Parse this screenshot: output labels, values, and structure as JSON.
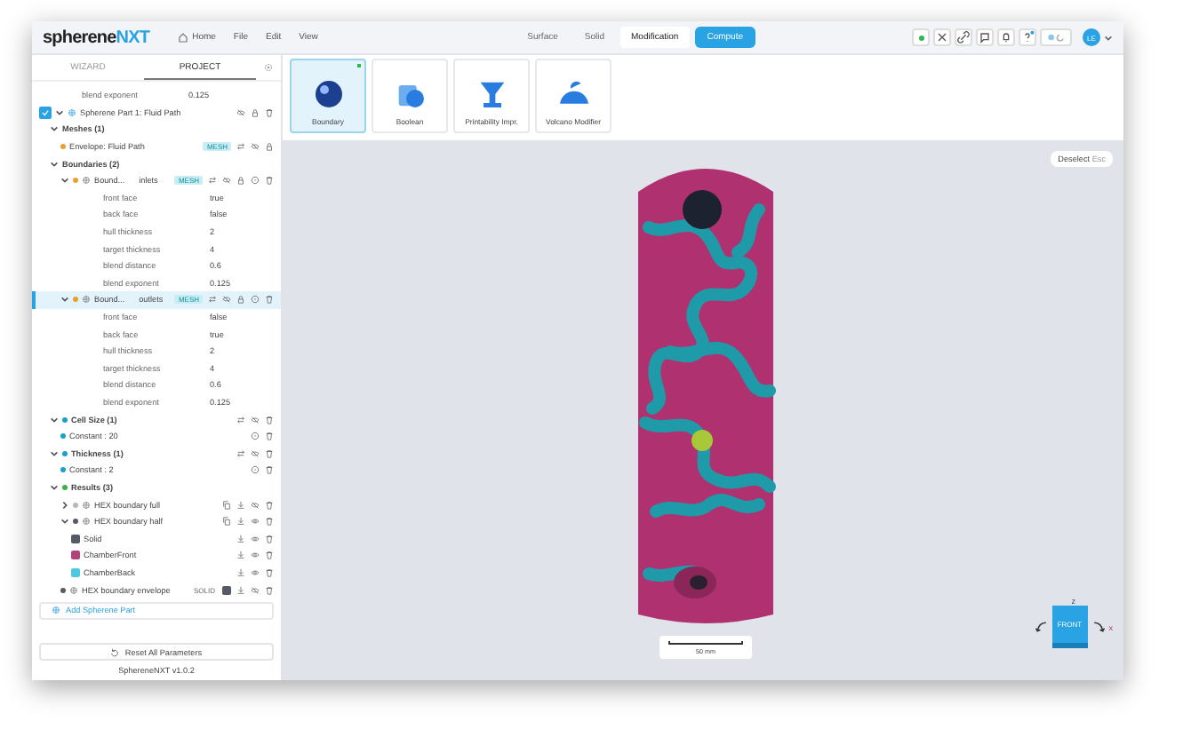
{
  "app": {
    "logo_main": "spherene",
    "logo_accent": "NXT",
    "menu": [
      {
        "label": "Home",
        "kind": "home"
      },
      {
        "label": "File",
        "kind": "plain"
      },
      {
        "label": "Edit",
        "kind": "plain"
      },
      {
        "label": "View",
        "kind": "plain"
      }
    ],
    "modes": [
      {
        "label": "Surface",
        "selected": false
      },
      {
        "label": "Solid",
        "selected": false
      },
      {
        "label": "Modification",
        "selected": true
      }
    ],
    "compute_button": "Compute",
    "user_initials": "LE"
  },
  "sidebar": {
    "tabs": [
      {
        "label": "WIZARD",
        "selected": false
      },
      {
        "label": "PROJECT",
        "selected": true
      }
    ],
    "top_props": [
      {
        "name": "blend exponent",
        "value": "0.125"
      }
    ],
    "tree": [
      {
        "label": "Spherene Part 1: Fluid Path",
        "kind": "part",
        "checked": true,
        "expanded": true,
        "selected": false,
        "actions": [
          {
            "kind": "hide"
          },
          {
            "kind": "lock"
          },
          {
            "kind": "delete"
          }
        ],
        "children": [
          {
            "label": "Meshes (1)",
            "kind": "group",
            "expanded": true,
            "selected": false,
            "children": [
              {
                "label": "Envelope: Fluid Path",
                "kind": "item",
                "color": "#e8a030",
                "tag": "MESH",
                "selected": false,
                "actions": [
                  {
                    "kind": "swap"
                  },
                  {
                    "kind": "hide"
                  },
                  {
                    "kind": "lock"
                  }
                ]
              }
            ]
          },
          {
            "label": "Boundaries (2)",
            "kind": "group",
            "expanded": true,
            "selected": false,
            "children": [
              {
                "label": "Bound...",
                "secondary": "inlets",
                "kind": "boundary",
                "color": "#e8a030",
                "tag": "MESH",
                "expanded": true,
                "selected": false,
                "actions": [
                  {
                    "kind": "swap"
                  },
                  {
                    "kind": "hide"
                  },
                  {
                    "kind": "lock"
                  },
                  {
                    "kind": "target"
                  },
                  {
                    "kind": "delete"
                  }
                ],
                "props": [
                  {
                    "name": "front face",
                    "value": "true"
                  },
                  {
                    "name": "back face",
                    "value": "false"
                  },
                  {
                    "name": "hull thickness",
                    "value": "2"
                  },
                  {
                    "name": "target thickness",
                    "value": "4"
                  },
                  {
                    "name": "blend distance",
                    "value": "0.6"
                  },
                  {
                    "name": "blend exponent",
                    "value": "0.125"
                  }
                ]
              },
              {
                "label": "Bound...",
                "secondary": "outlets",
                "kind": "boundary",
                "color": "#e8a030",
                "tag": "MESH",
                "expanded": true,
                "selected": true,
                "actions": [
                  {
                    "kind": "swap"
                  },
                  {
                    "kind": "hide"
                  },
                  {
                    "kind": "lock"
                  },
                  {
                    "kind": "target"
                  },
                  {
                    "kind": "delete"
                  }
                ],
                "props": [
                  {
                    "name": "front face",
                    "value": "false"
                  },
                  {
                    "name": "back face",
                    "value": "true"
                  },
                  {
                    "name": "hull thickness",
                    "value": "2"
                  },
                  {
                    "name": "target thickness",
                    "value": "4"
                  },
                  {
                    "name": "blend distance",
                    "value": "0.6"
                  },
                  {
                    "name": "blend exponent",
                    "value": "0.125"
                  }
                ]
              }
            ]
          },
          {
            "label": "Cell Size (1)",
            "kind": "group",
            "color": "#1ba0c8",
            "expanded": true,
            "selected": false,
            "actions": [
              {
                "kind": "swap"
              },
              {
                "kind": "hide"
              },
              {
                "kind": "delete"
              }
            ],
            "children": [
              {
                "label": "Constant : 20",
                "kind": "item",
                "color": "#1ba0c8",
                "selected": false,
                "actions": [
                  {
                    "kind": "target"
                  },
                  {
                    "kind": "delete"
                  }
                ]
              }
            ]
          },
          {
            "label": "Thickness (1)",
            "kind": "group",
            "color": "#1ba0c8",
            "expanded": true,
            "selected": false,
            "actions": [
              {
                "kind": "swap"
              },
              {
                "kind": "hide"
              },
              {
                "kind": "delete"
              }
            ],
            "children": [
              {
                "label": "Constant : 2",
                "kind": "item",
                "color": "#1ba0c8",
                "selected": false,
                "actions": [
                  {
                    "kind": "target"
                  },
                  {
                    "kind": "delete"
                  }
                ]
              }
            ]
          },
          {
            "label": "Results (3)",
            "kind": "group",
            "color": "#3cb04a",
            "expanded": true,
            "selected": false,
            "children": [
              {
                "label": "HEX boundary full",
                "kind": "result",
                "color": "#b8b8b8",
                "expanded": false,
                "selected": false,
                "actions": [
                  {
                    "kind": "copy"
                  },
                  {
                    "kind": "download"
                  },
                  {
                    "kind": "hide"
                  },
                  {
                    "kind": "delete"
                  }
                ]
              },
              {
                "label": "HEX boundary half",
                "kind": "result",
                "color": "#555a66",
                "expanded": true,
                "selected": false,
                "actions": [
                  {
                    "kind": "copy"
                  },
                  {
                    "kind": "download"
                  },
                  {
                    "kind": "eye"
                  },
                  {
                    "kind": "delete"
                  }
                ],
                "children": [
                  {
                    "label": "Solid",
                    "kind": "swatch",
                    "color": "#555a66",
                    "selected": false,
                    "actions": [
                      {
                        "kind": "download"
                      },
                      {
                        "kind": "eye"
                      },
                      {
                        "kind": "delete"
                      }
                    ]
                  },
                  {
                    "label": "ChamberFront",
                    "kind": "swatch",
                    "color": "#b0437a",
                    "selected": false,
                    "actions": [
                      {
                        "kind": "download"
                      },
                      {
                        "kind": "eye"
                      },
                      {
                        "kind": "delete"
                      }
                    ]
                  },
                  {
                    "label": "ChamberBack",
                    "kind": "swatch",
                    "color": "#4cc8e0",
                    "selected": false,
                    "actions": [
                      {
                        "kind": "download"
                      },
                      {
                        "kind": "eye"
                      },
                      {
                        "kind": "delete"
                      }
                    ]
                  }
                ]
              },
              {
                "label": "HEX boundary envelope",
                "kind": "result",
                "color": "#555a66",
                "tag": "SOLID",
                "swatch": {
                  "color": "#555a66"
                },
                "selected": false,
                "actions": [
                  {
                    "kind": "download"
                  },
                  {
                    "kind": "hide"
                  },
                  {
                    "kind": "delete"
                  }
                ]
              }
            ]
          }
        ]
      }
    ],
    "add_part": "Add Spherene Part",
    "reset": "Reset All Parameters",
    "version": "SphereneNXT v1.0.2"
  },
  "modifiers": [
    {
      "label": "Boundary",
      "selected": true
    },
    {
      "label": "Boolean",
      "selected": false
    },
    {
      "label": "Printability Impr.",
      "selected": false
    },
    {
      "label": "Volcano Modifier",
      "selected": false
    }
  ],
  "viewport": {
    "deselect": "Deselect",
    "deselect_key": "Esc",
    "scale": "50 mm",
    "cube_face": "FRONT",
    "axis_z": "z",
    "axis_x": "x"
  }
}
